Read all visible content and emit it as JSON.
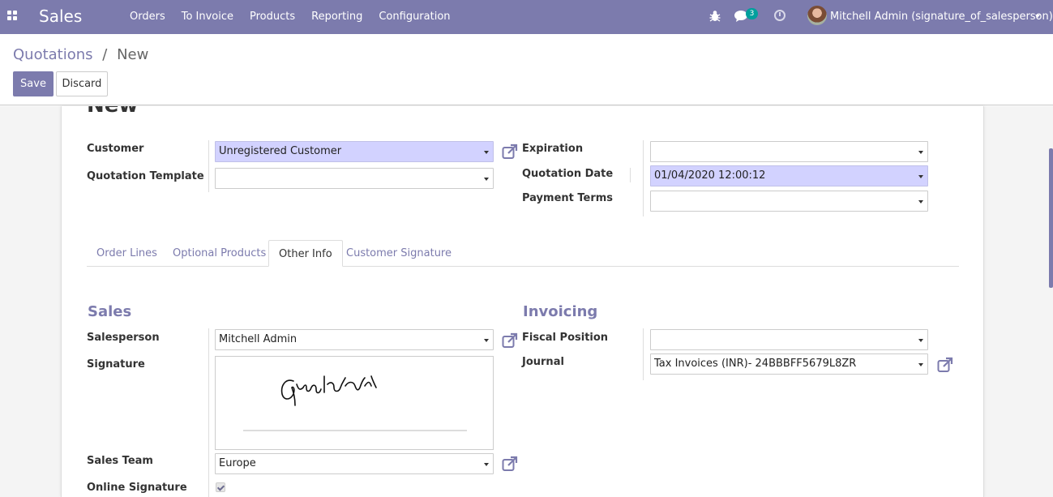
{
  "navbar": {
    "app_name": "Sales",
    "menu": [
      "Orders",
      "To Invoice",
      "Products",
      "Reporting",
      "Configuration"
    ],
    "chat_badge": "3",
    "user": "Mitchell Admin (signature_of_salesperson)",
    "icons": [
      "apps-icon",
      "bug-icon",
      "chat-icon",
      "clock-icon",
      "avatar",
      "caret-down-icon"
    ]
  },
  "breadcrumb": {
    "parent": "Quotations",
    "separator": "/",
    "current": "New"
  },
  "buttons": {
    "save": "Save",
    "discard": "Discard"
  },
  "record": {
    "title": "New",
    "customer_label": "Customer",
    "customer_value": "Unregistered Customer",
    "template_label": "Quotation Template",
    "template_value": "",
    "expiration_label": "Expiration",
    "expiration_value": "",
    "date_label": "Quotation Date",
    "date_value": "01/04/2020 12:00:12",
    "payment_label": "Payment Terms",
    "payment_value": ""
  },
  "tabs": [
    {
      "label": "Order Lines",
      "active": false
    },
    {
      "label": "Optional Products",
      "active": false
    },
    {
      "label": "Other Info",
      "active": true
    },
    {
      "label": "Customer Signature",
      "active": false
    }
  ],
  "sales": {
    "heading": "Sales",
    "salesperson_label": "Salesperson",
    "salesperson_value": "Mitchell Admin",
    "signature_label": "Signature",
    "team_label": "Sales Team",
    "team_value": "Europe",
    "online_signature_label": "Online Signature",
    "online_signature_checked": true
  },
  "invoicing": {
    "heading": "Invoicing",
    "fiscal_label": "Fiscal Position",
    "fiscal_value": "",
    "journal_label": "Journal",
    "journal_value": "Tax Invoices (INR)- 24BBBFF5679L8ZR"
  },
  "colors": {
    "primary": "#7c7bad",
    "required_field": "#d2d2ff",
    "badge": "#00a09d"
  }
}
